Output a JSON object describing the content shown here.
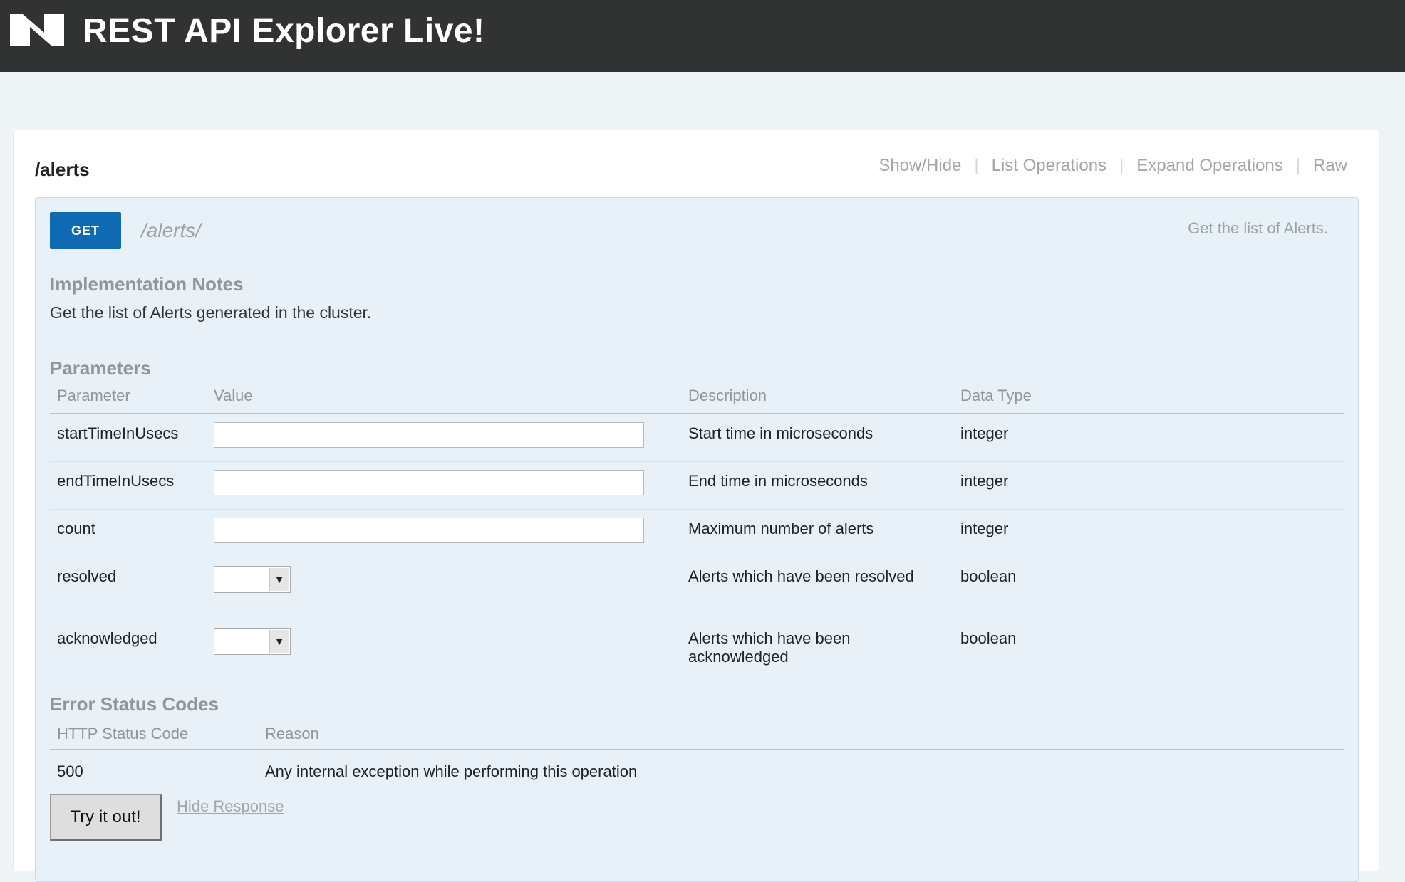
{
  "header": {
    "title": "REST API Explorer Live!",
    "logo_icon": "nutanix-logo-icon"
  },
  "resource": {
    "path": "/alerts",
    "links": [
      "Show/Hide",
      "List Operations",
      "Expand Operations",
      "Raw"
    ]
  },
  "operation": {
    "method": "GET",
    "path": "/alerts/",
    "summary": "Get the list of Alerts.",
    "impl_heading": "Implementation Notes",
    "impl_notes": "Get the list of Alerts generated in the cluster.",
    "params_heading": "Parameters",
    "param_columns": [
      "Parameter",
      "Value",
      "Description",
      "Data Type"
    ],
    "params": [
      {
        "name": "startTimeInUsecs",
        "input": "text",
        "value": "",
        "description": "Start time in microseconds",
        "type": "integer"
      },
      {
        "name": "endTimeInUsecs",
        "input": "text",
        "value": "",
        "description": "End time in microseconds",
        "type": "integer"
      },
      {
        "name": "count",
        "input": "text",
        "value": "",
        "description": "Maximum number of alerts",
        "type": "integer"
      },
      {
        "name": "resolved",
        "input": "select",
        "value": "",
        "description": "Alerts which have been resolved",
        "type": "boolean"
      },
      {
        "name": "acknowledged",
        "input": "select",
        "value": "",
        "description": "Alerts which have been acknowledged",
        "type": "boolean"
      }
    ],
    "errors_heading": "Error Status Codes",
    "error_columns": [
      "HTTP Status Code",
      "Reason"
    ],
    "errors": [
      {
        "code": "500",
        "reason": "Any internal exception while performing this operation"
      }
    ],
    "try_label": "Try it out!",
    "hide_response_label": "Hide Response"
  },
  "colors": {
    "header_bg": "#313333",
    "get_badge": "#0f6ab4",
    "operation_bg": "#e8f1f7"
  }
}
